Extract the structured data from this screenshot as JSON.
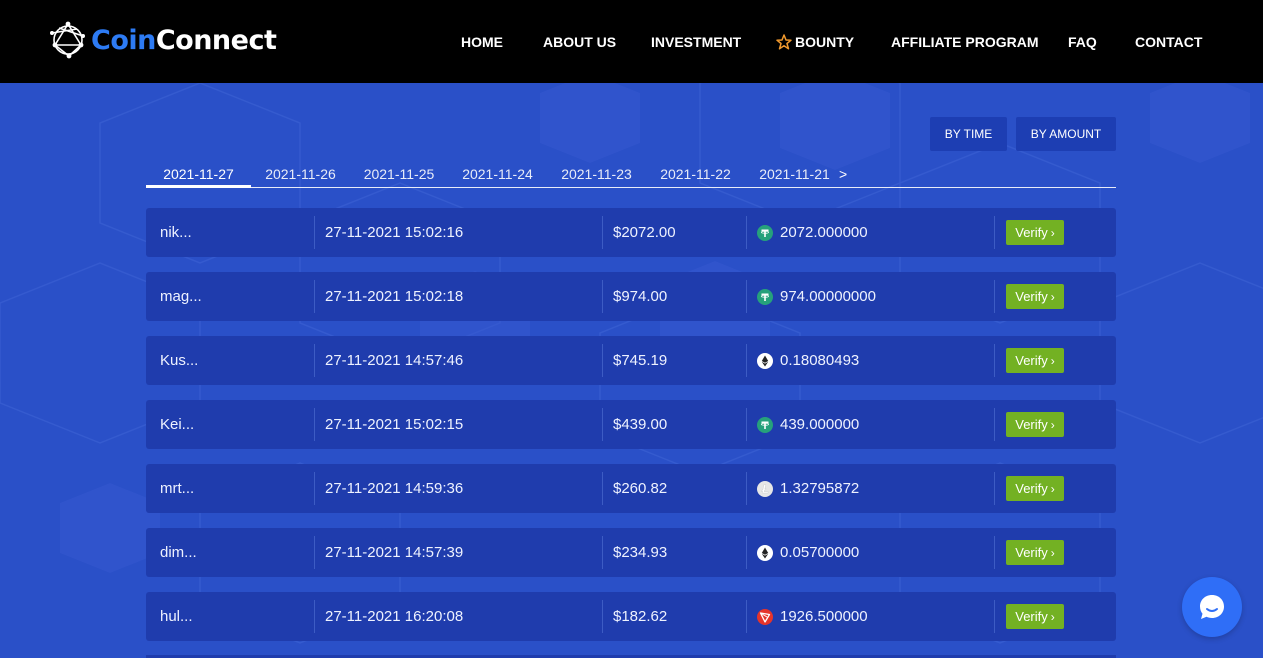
{
  "brand": {
    "name_part1": "Coin",
    "name_part2": "Connect",
    "accent": "#2d7bf4"
  },
  "nav": {
    "items": [
      {
        "label": "HOME"
      },
      {
        "label": "ABOUT US"
      },
      {
        "label": "INVESTMENT"
      },
      {
        "label": "BOUNTY",
        "icon": "star-icon"
      },
      {
        "label": "AFFILIATE PROGRAM"
      },
      {
        "label": "FAQ"
      },
      {
        "label": "CONTACT"
      }
    ]
  },
  "sort": {
    "by_time": "BY TIME",
    "by_amount": "BY AMOUNT"
  },
  "date_tabs": {
    "active_index": 0,
    "items": [
      "2021-11-27",
      "2021-11-26",
      "2021-11-25",
      "2021-11-24",
      "2021-11-23",
      "2021-11-22",
      "2021-11-21"
    ],
    "next_label": ">"
  },
  "transactions": [
    {
      "user": "nik...",
      "datetime": "27-11-2021 15:02:16",
      "usd": "$2072.00",
      "coin_icon": "tether-icon",
      "crypto": "2072.000000",
      "verify": "Verify"
    },
    {
      "user": "mag...",
      "datetime": "27-11-2021 15:02:18",
      "usd": "$974.00",
      "coin_icon": "tether-icon",
      "crypto": "974.00000000",
      "verify": "Verify"
    },
    {
      "user": "Kus...",
      "datetime": "27-11-2021 14:57:46",
      "usd": "$745.19",
      "coin_icon": "ethereum-icon",
      "crypto": "0.18080493",
      "verify": "Verify"
    },
    {
      "user": "Kei...",
      "datetime": "27-11-2021 15:02:15",
      "usd": "$439.00",
      "coin_icon": "tether-icon",
      "crypto": "439.000000",
      "verify": "Verify"
    },
    {
      "user": "mrt...",
      "datetime": "27-11-2021 14:59:36",
      "usd": "$260.82",
      "coin_icon": "litecoin-icon",
      "crypto": "1.32795872",
      "verify": "Verify"
    },
    {
      "user": "dim...",
      "datetime": "27-11-2021 14:57:39",
      "usd": "$234.93",
      "coin_icon": "ethereum-icon",
      "crypto": "0.05700000",
      "verify": "Verify"
    },
    {
      "user": "hul...",
      "datetime": "27-11-2021 16:20:08",
      "usd": "$182.62",
      "coin_icon": "tron-icon",
      "crypto": "1926.500000",
      "verify": "Verify"
    }
  ],
  "colors": {
    "page_bg": "#2a50c8",
    "row_bg": "#1f3cad",
    "verify_green": "#73b123",
    "tether": "#26a17b",
    "tron": "#e5342b",
    "chat": "#2f6ef7"
  },
  "chat_widget": {
    "icon": "chat-bubble-icon"
  }
}
